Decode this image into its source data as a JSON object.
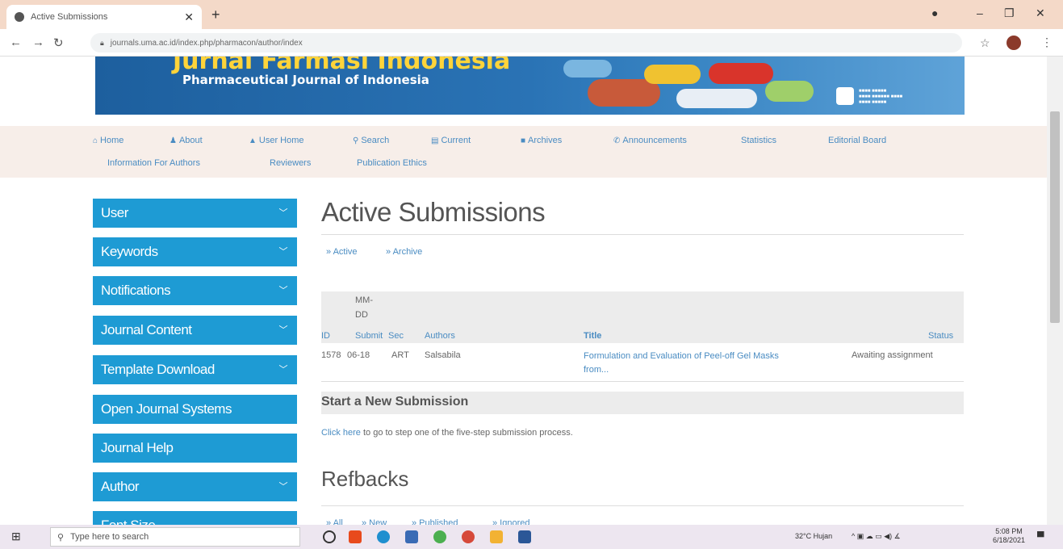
{
  "browser": {
    "tab_title": "Active Submissions",
    "url": "journals.uma.ac.id/index.php/pharmacon/author/index"
  },
  "banner": {
    "title": "Jurnal Farmasi Indonesia",
    "subtitle": "Pharmaceutical Journal of Indonesia"
  },
  "nav": {
    "home": "Home",
    "about": "About",
    "user_home": "User Home",
    "search": "Search",
    "current": "Current",
    "archives": "Archives",
    "announcements": "Announcements",
    "statistics": "Statistics",
    "editorial_board": "Editorial Board",
    "info_authors": "Information For Authors",
    "reviewers": "Reviewers",
    "publication_ethics": "Publication Ethics"
  },
  "sidebar": {
    "items": [
      {
        "label": "User"
      },
      {
        "label": "Keywords"
      },
      {
        "label": "Notifications"
      },
      {
        "label": "Journal Content"
      },
      {
        "label": "Template Download"
      },
      {
        "label": "Open Journal Systems"
      },
      {
        "label": "Journal Help"
      },
      {
        "label": "Author"
      },
      {
        "label": "Font Size"
      }
    ]
  },
  "main": {
    "title": "Active Submissions",
    "filter_active": "» Active",
    "filter_archive": "» Archive",
    "table": {
      "headers": {
        "id": "ID",
        "date_line1": "MM-",
        "date_line2": "DD",
        "date_line3": "Submit",
        "sec": "Sec",
        "authors": "Authors",
        "title": "Title",
        "status": "Status"
      },
      "rows": [
        {
          "id": "1578",
          "date": "06-18",
          "sec": "ART",
          "authors": "Salsabila",
          "title": "Formulation and Evaluation of Peel-off Gel Masks from...",
          "status": "Awaiting assignment"
        }
      ]
    },
    "new_submission": {
      "heading": "Start a New Submission",
      "link": "Click here",
      "rest": "to go to step one of the five-step submission process."
    },
    "refbacks": {
      "heading": "Refbacks",
      "filters": [
        "» All",
        "» New",
        "» Published",
        "» Ignored"
      ]
    }
  },
  "taskbar": {
    "search_placeholder": "Type here to search",
    "weather": "32°C  Hujan",
    "time": "5:08 PM",
    "date": "6/18/2021"
  }
}
